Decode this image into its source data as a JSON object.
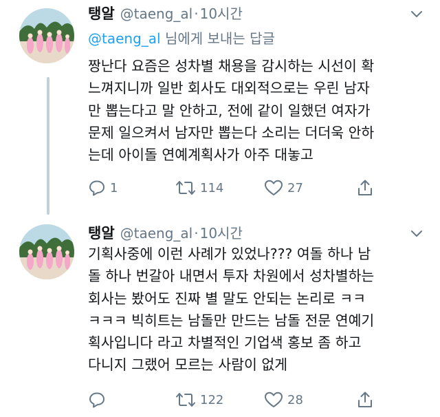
{
  "colors": {
    "link": "#1da1f2",
    "secondary_text": "#657786",
    "primary_text": "#14171a",
    "thread_line": "#c4cfd6"
  },
  "tweets": [
    {
      "display_name": "탱알",
      "handle": "@taeng_al",
      "separator": "·",
      "time": "10시간",
      "reply_to_handle": "@taeng_al",
      "reply_to_suffix": " 님에게 보내는 답글",
      "lines": [
        "짱난다 요즘은 성차별 채용을 감시하는 시선이 확",
        "느껴지니까 일반 회사도 대외적으로는 우린 남자",
        "만 뽑는다고 말 안하고, 전에 같이 일했던 여자가",
        "문제 일으켜서 남자만 뽑는다 소리는 더더욱 안하",
        "는데 아이돌 연예계획사가 아주 대놓고"
      ],
      "reply_count": "1",
      "retweet_count": "114",
      "like_count": "27",
      "icons": [
        "reply-icon",
        "retweet-icon",
        "like-icon",
        "share-icon"
      ]
    },
    {
      "display_name": "탱알",
      "handle": "@taeng_al",
      "separator": "·",
      "time": "10시간",
      "lines": [
        "기획사중에 이런 사례가 있었나??? 여돌 하나 남",
        "돌 하나 번갈아 내면서 투자 차원에서 성차별하는",
        "회사는 봤어도 진짜 별 말도 안되는 논리로 ㅋㅋ",
        "ㅋㅋㅋ 빅히트는 남돌만 만드는 남돌 전문 연예기",
        "획사입니다 라고 차별적인 기업색 홍보 좀 하고",
        "다니지 그랬어 모르는 사람이 없게"
      ],
      "reply_count": "",
      "retweet_count": "122",
      "like_count": "28",
      "icons": [
        "reply-icon",
        "retweet-icon",
        "like-icon",
        "share-icon"
      ]
    }
  ]
}
